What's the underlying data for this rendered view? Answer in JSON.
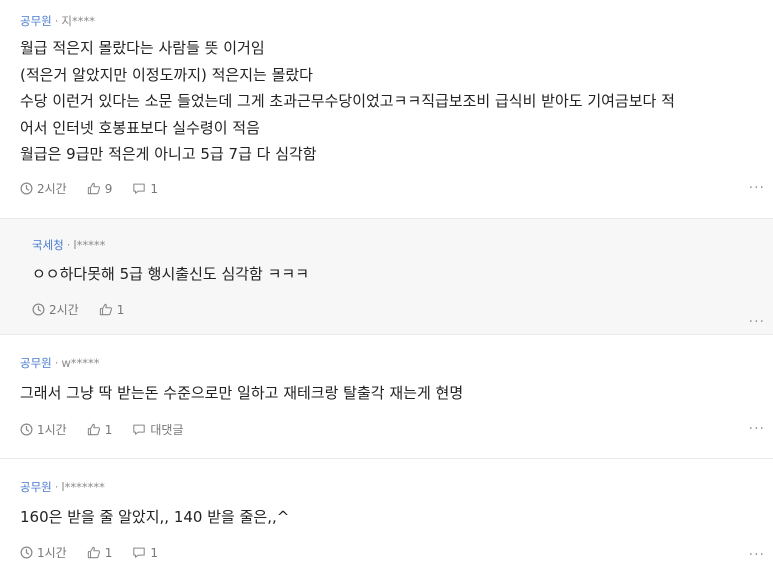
{
  "comments": [
    {
      "org": "공무원",
      "user": "지****",
      "body": "월급 적은지 몰랐다는 사람들 뜻 이거임\n(적은거 알았지만 이정도까지) 적은지는 몰랐다\n수당 이런거 있다는 소문 들었는데 그게 초과근무수당이었고ㅋㅋ직급보조비 급식비 받아도 기여금보다 적\n어서 인터넷 호봉표보다 실수령이 적음\n월급은 9급만 적은게 아니고 5급 7급 다 심각함",
      "time": "2시간",
      "likes": "9",
      "replies": "1"
    },
    {
      "org": "국세청",
      "user": "l*****",
      "body": "ㅇㅇ하다못해 5급 행시출신도 심각함 ㅋㅋㅋ",
      "time": "2시간",
      "likes": "1"
    },
    {
      "org": "공무원",
      "user": "w*****",
      "body": "그래서 그냥 딱 받는돈 수준으로만 일하고 재테크랑 탈출각 재는게 현명",
      "time": "1시간",
      "likes": "1",
      "replies": "대댓글"
    },
    {
      "org": "공무원",
      "user": "l*******",
      "body": "160은 받을 줄 알았지,, 140 받을 줄은,,^",
      "time": "1시간",
      "likes": "1",
      "replies": "1"
    }
  ],
  "more_label": "···",
  "meta_sep": "·",
  "icons": {
    "time": "clock-icon",
    "like": "thumbs-up-icon",
    "reply": "speech-bubble-icon",
    "more": "more-icon"
  },
  "colors": {
    "org": "#4a7bd0",
    "reply_bg": "#f7f7f8",
    "divider": "#ebebeb"
  }
}
